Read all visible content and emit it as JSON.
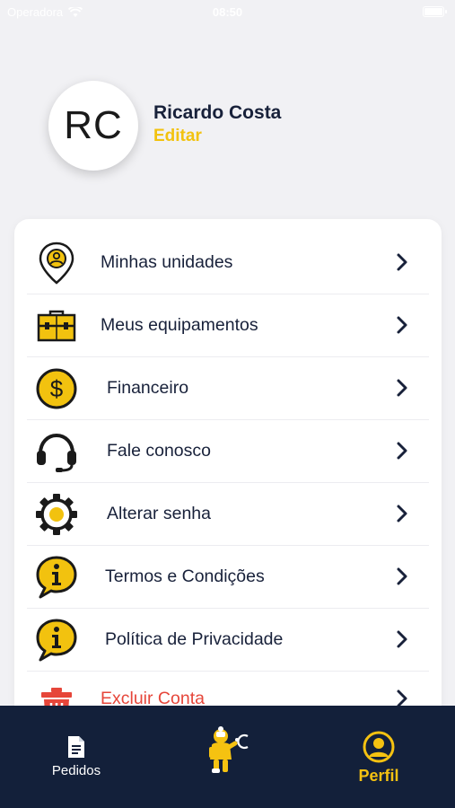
{
  "status_bar": {
    "carrier": "Operadora",
    "time": "08:50",
    "battery_level": 1.0
  },
  "profile": {
    "initials": "RC",
    "name": "Ricardo Costa",
    "edit_label": "Editar"
  },
  "colors": {
    "accent": "#f2c20f",
    "navy": "#13203a",
    "danger": "#e6463a",
    "background": "#f1f1f4"
  },
  "menu": {
    "items": [
      {
        "label": "Minhas unidades",
        "icon": "location-pin-icon"
      },
      {
        "label": "Meus equipamentos",
        "icon": "toolbox-icon"
      },
      {
        "label": "Financeiro",
        "icon": "dollar-coin-icon"
      },
      {
        "label": "Fale conosco",
        "icon": "headset-icon"
      },
      {
        "label": "Alterar senha",
        "icon": "gear-icon"
      },
      {
        "label": "Termos e Condições",
        "icon": "info-bubble-icon"
      },
      {
        "label": "Política de Privacidade",
        "icon": "info-bubble-icon"
      },
      {
        "label": "Excluir Conta",
        "icon": "trash-icon"
      }
    ]
  },
  "tab_bar": {
    "tabs": [
      {
        "label": "Pedidos",
        "icon": "document-icon",
        "active": false
      },
      {
        "label": "",
        "icon": "mascot-logo-icon",
        "active": false
      },
      {
        "label": "Perfil",
        "icon": "user-icon",
        "active": true
      }
    ]
  }
}
